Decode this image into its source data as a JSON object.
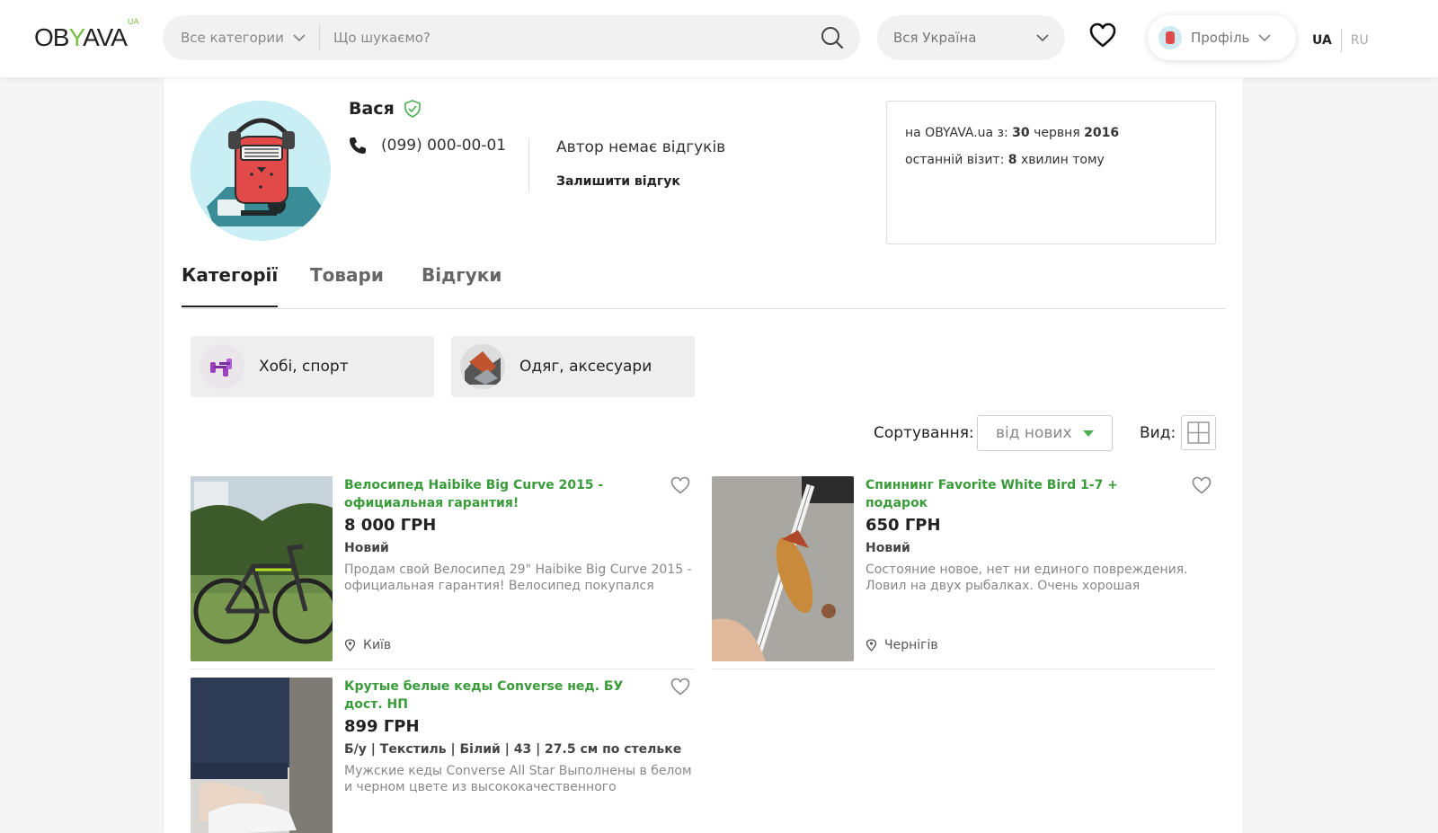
{
  "header": {
    "logo_text": "OB",
    "logo_y": "Y",
    "logo_text2": "AVA",
    "logo_sup": "UA",
    "category_select": "Все категории",
    "search_placeholder": "Що шукаємо?",
    "region_select": "Вся Україна",
    "profile_label": "Профіль",
    "lang_active": "UA",
    "lang_inactive": "RU"
  },
  "seller": {
    "name": "Вася",
    "phone": "(099) 000-00-01",
    "reviews_status": "Автор немає відгуків",
    "leave_review": "Залишити відгук",
    "since_prefix": "на OBYAVA.ua з:",
    "since_day": "30",
    "since_month": "червня",
    "since_year": "2016",
    "last_visit_prefix": "останній візит:",
    "last_visit_value": "8",
    "last_visit_suffix": "хвилин тому"
  },
  "tabs": [
    {
      "label": "Категорії",
      "active": true
    },
    {
      "label": "Товари",
      "active": false
    },
    {
      "label": "Відгуки",
      "active": false
    }
  ],
  "categories": [
    {
      "label": "Хобі, спорт"
    },
    {
      "label": "Одяг, аксесуари"
    }
  ],
  "toolbar": {
    "sort_label": "Сортування:",
    "sort_value": "від нових",
    "view_label": "Вид:"
  },
  "listings": [
    {
      "title": "Велосипед Haibike Big Curve 2015 - официальная гарантия!",
      "price": "8 000 ГРН",
      "condition": "Новий",
      "description": "Продам свой Велосипед 29\" Haibike Big Curve 2015 - официальная гарантия! Велосипед покупался",
      "location": "Київ"
    },
    {
      "title": "Спиннинг Favorite White Bird 1-7 + подарок",
      "price": "650 ГРН",
      "condition": "Новий",
      "description": "Состояние новое, нет ни единого повреждения. Ловил на двух рыбалках. Очень хорошая",
      "location": "Чернігів"
    },
    {
      "title": "Крутые белые кеды Converse нед. БУ дост. НП",
      "price": "899 ГРН",
      "condition": "Б/у | Текстиль | Білий | 43 | 27.5 см по стельке",
      "description": "Мужские кеды Converse All Star Выполнены в белом и черном цвете из высококачественного",
      "location": ""
    }
  ],
  "colors": {
    "accent_green": "#3a9b3a",
    "logo_green": "#7bc043"
  }
}
